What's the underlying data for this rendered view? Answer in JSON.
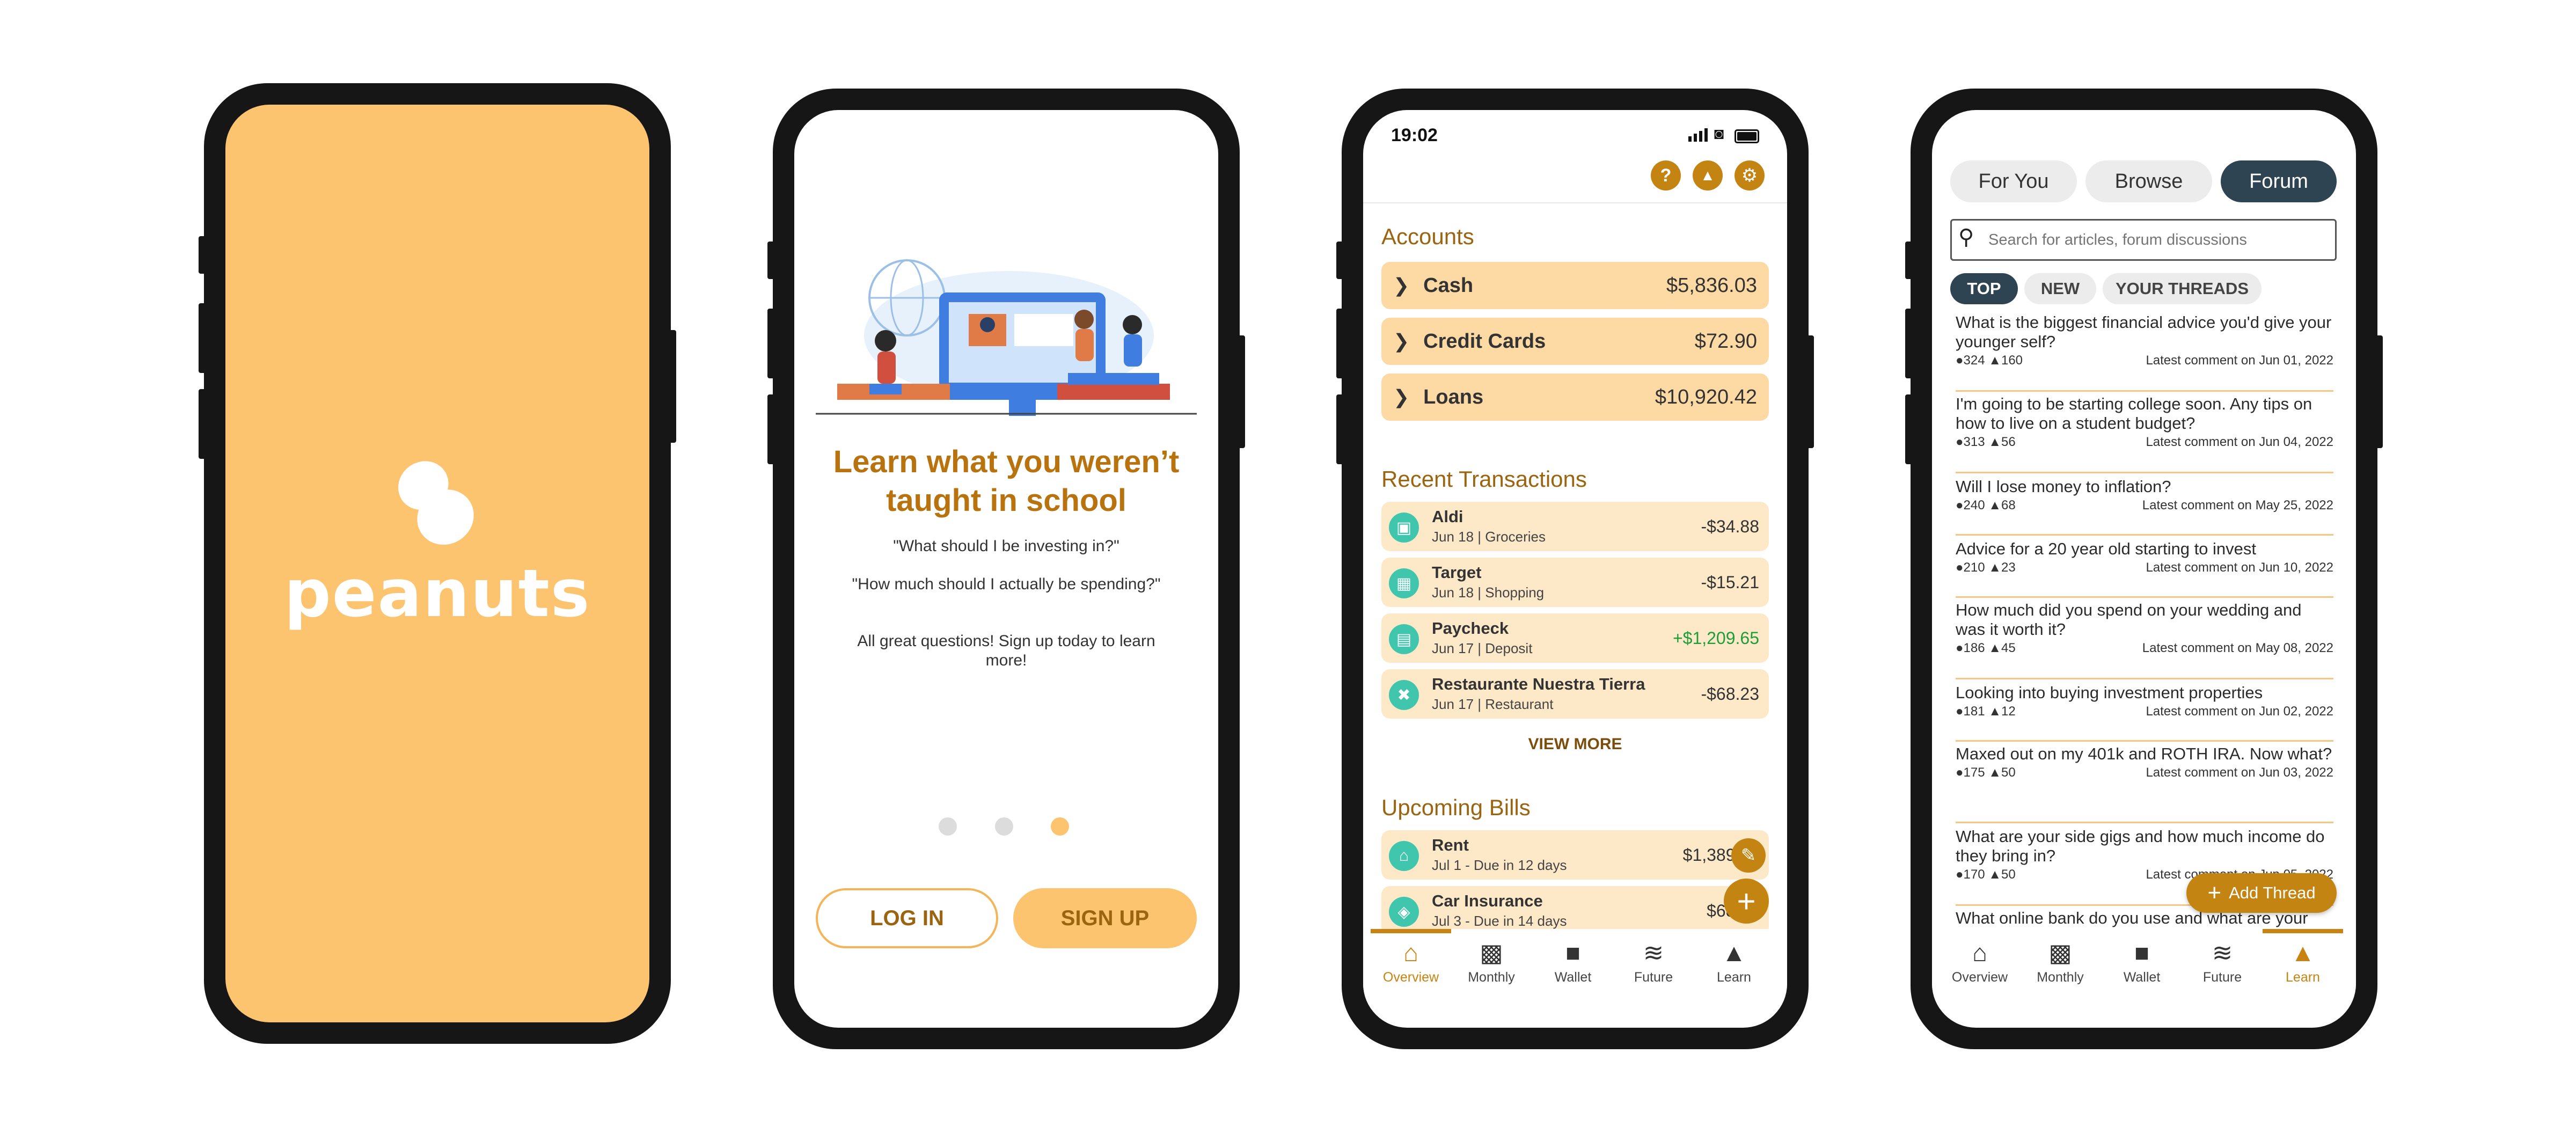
{
  "splash": {
    "logo_text": "peanuts",
    "bg_color": "#fdc46f"
  },
  "onboarding": {
    "headline": "Learn what you weren’t taught in school",
    "quote1": "\"What should I be investing in?\"",
    "quote2": "\"How much should I actually be spending?\"",
    "cta_text": "All great questions! Sign up today to learn more!",
    "page_indicator": {
      "count": 3,
      "active": 3
    },
    "login_label": "LOG IN",
    "signup_label": "SIGN UP"
  },
  "overview": {
    "status_time": "19:02",
    "accounts_title": "Accounts",
    "accounts": [
      {
        "name": "Cash",
        "amount": "$5,836.03"
      },
      {
        "name": "Credit Cards",
        "amount": "$72.90"
      },
      {
        "name": "Loans",
        "amount": "$10,920.42"
      }
    ],
    "transactions_title": "Recent Transactions",
    "transactions": [
      {
        "name": "Aldi",
        "sub": "Jun 18 | Groceries",
        "amount": "-$34.88",
        "icon": "cart-icon"
      },
      {
        "name": "Target",
        "sub": "Jun 18 | Shopping",
        "amount": "-$15.21",
        "icon": "shopping-bag-icon"
      },
      {
        "name": "Paycheck",
        "sub": "Jun 17 | Deposit",
        "amount": "+$1,209.65",
        "icon": "bank-icon"
      },
      {
        "name": "Restaurante Nuestra Tierra",
        "sub": "Jun 17 | Restaurant",
        "amount": "-$68.23",
        "icon": "fork-knife-icon"
      }
    ],
    "view_more": "VIEW MORE",
    "bills_title": "Upcoming Bills",
    "bills": [
      {
        "name": "Rent",
        "sub": "Jul 1 - Due in 12 days",
        "amount": "$1,389.00",
        "icon": "house-icon"
      },
      {
        "name": "Car Insurance",
        "sub": "Jul 3 - Due in 14 days",
        "amount": "$68.25",
        "icon": "car-icon"
      }
    ],
    "positive_color": "#1f9d3a"
  },
  "nav": {
    "items": [
      "Overview",
      "Monthly",
      "Wallet",
      "Future",
      "Learn"
    ]
  },
  "forum": {
    "tabs": [
      "For You",
      "Browse",
      "Forum"
    ],
    "search_placeholder": "Search for articles, forum discussions",
    "chips": [
      "TOP",
      "NEW",
      "YOUR THREADS"
    ],
    "threads": [
      {
        "q": "What is the biggest financial advice you'd give your younger self?",
        "comments": "324",
        "likes": "160",
        "latest": "Latest comment on Jun 01, 2022"
      },
      {
        "q": "I'm going to be starting college soon. Any tips on how to live on a student budget?",
        "comments": "313",
        "likes": "56",
        "latest": "Latest comment on Jun 04, 2022"
      },
      {
        "q": "Will I lose money to inflation?",
        "comments": "240",
        "likes": "68",
        "latest": "Latest comment on May 25, 2022"
      },
      {
        "q": "Advice for a 20 year old starting to invest",
        "comments": "210",
        "likes": "23",
        "latest": "Latest comment on Jun 10, 2022"
      },
      {
        "q": "How much did you spend on your wedding and was it worth it?",
        "comments": "186",
        "likes": "45",
        "latest": "Latest comment on May 08, 2022"
      },
      {
        "q": "Looking into buying investment properties",
        "comments": "181",
        "likes": "12",
        "latest": "Latest comment on Jun 02, 2022"
      },
      {
        "q": "Maxed out on my 401k and ROTH IRA. Now what?",
        "comments": "175",
        "likes": "50",
        "latest": "Latest comment on Jun 03, 2022"
      },
      {
        "q": "What are your side gigs and how much income do they bring in?",
        "comments": "170",
        "likes": "50",
        "latest": "Latest comment on Jun 05, 2022"
      },
      {
        "q": "What online bank do you use and what are your",
        "comments": "",
        "likes": "",
        "latest": ""
      }
    ],
    "add_thread": "Add Thread"
  },
  "colors": {
    "accent": "#c48412",
    "peach": "#fdc46f",
    "dark_tab": "#2e4453",
    "teal": "#3fc6ad"
  }
}
